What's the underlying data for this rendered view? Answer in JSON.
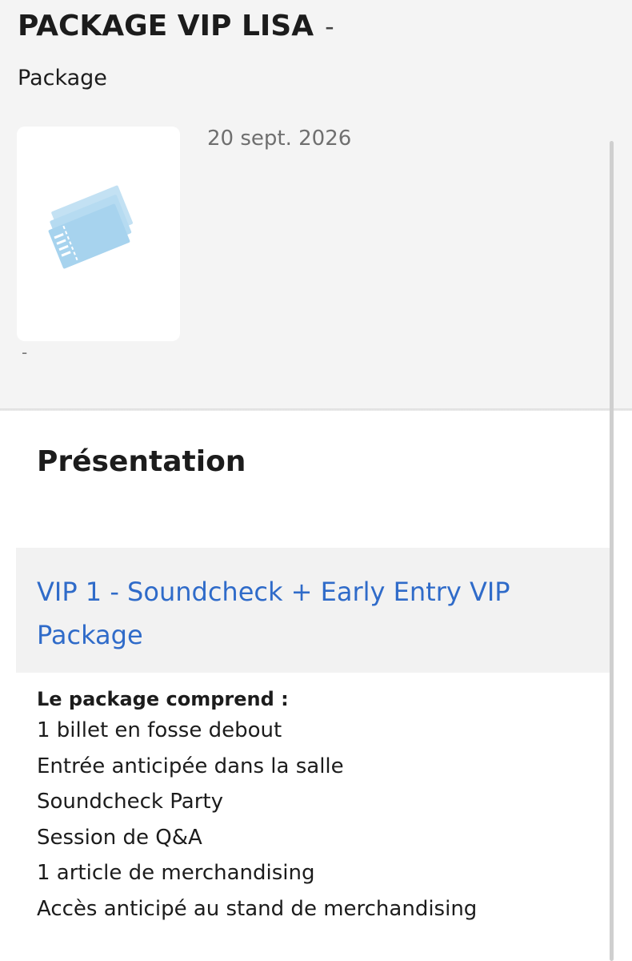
{
  "header": {
    "title": "PACKAGE VIP LISA",
    "title_suffix": "-",
    "subtitle": "Package"
  },
  "event": {
    "date": "20 sept. 2026",
    "thumbnail_icon": "ticket-icon",
    "extra": "-"
  },
  "presentation": {
    "heading": "Présentation",
    "package_name": "VIP 1 - Soundcheck + Early Entry VIP Package",
    "includes_heading": "Le package comprend :",
    "items": [
      "1 billet en fosse debout",
      "Entrée anticipée dans la salle",
      "Soundcheck Party",
      "Session de Q&A",
      "1 article de merchandising",
      "Accès anticipé au stand de merchandising"
    ]
  },
  "colors": {
    "link_blue": "#2f6bc9",
    "ticket_blue": "#a7d3ee",
    "header_bg": "#f4f4f4"
  }
}
